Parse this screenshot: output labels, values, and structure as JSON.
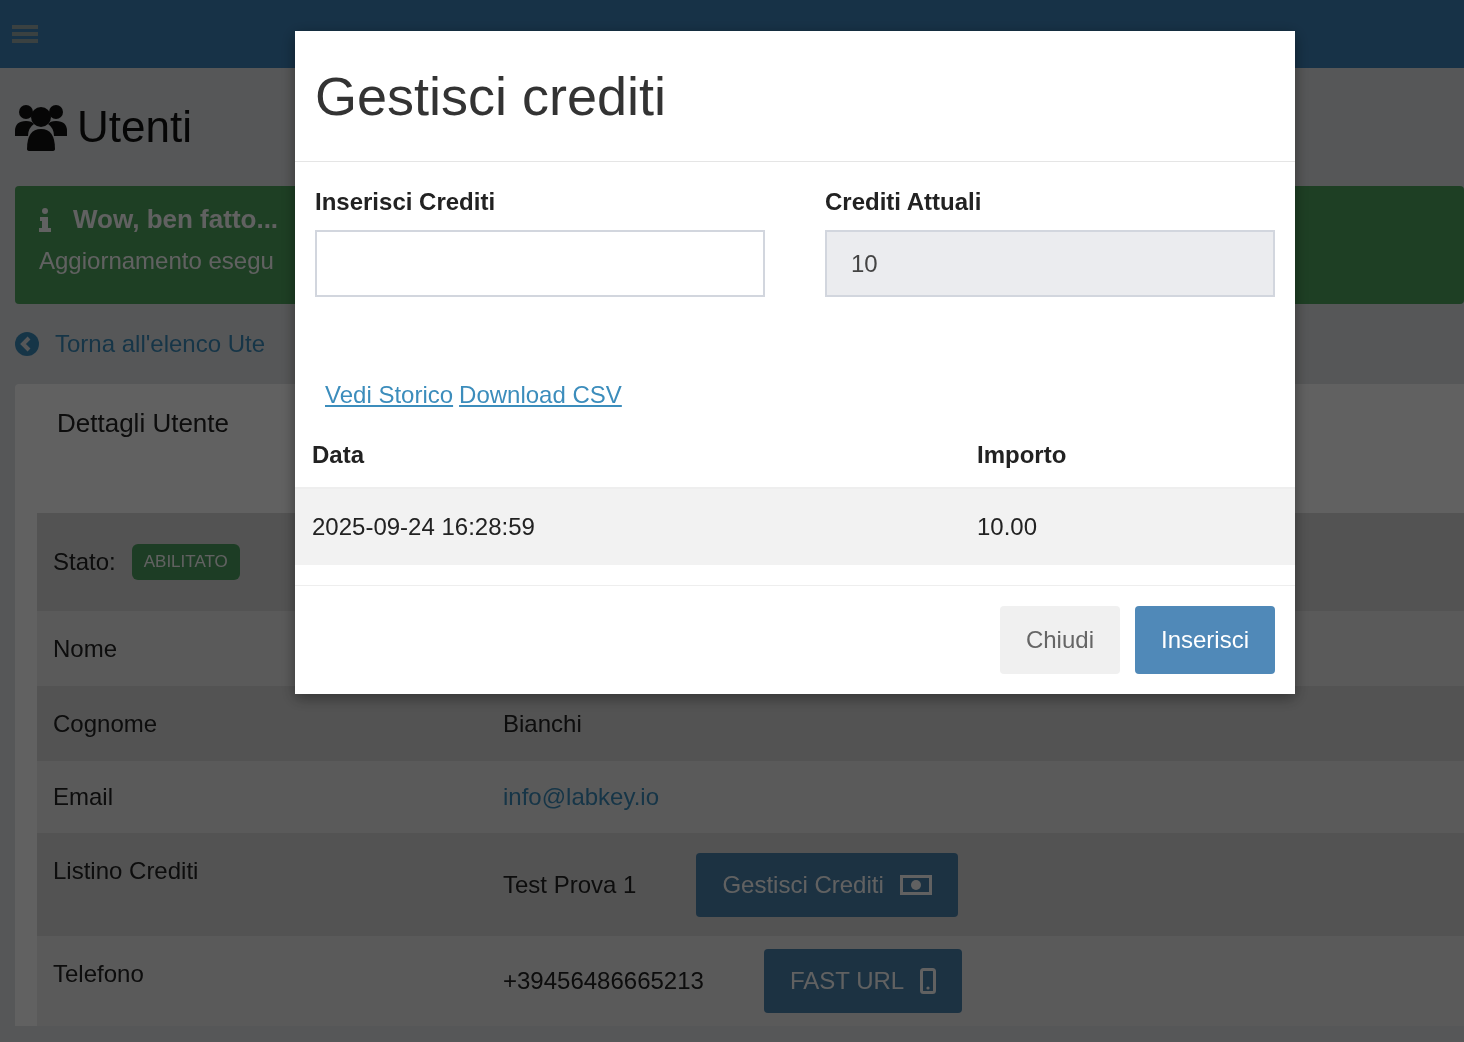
{
  "page": {
    "title": "Utenti",
    "alert": {
      "title": "Wow, ben fatto...",
      "message": "Aggiornamento esegu"
    },
    "back_link": "Torna all'elenco Ute",
    "card": {
      "title": "Dettagli Utente",
      "status": {
        "label": "Stato:",
        "badge": "ABILITATO"
      },
      "rows": [
        {
          "label": "Nome"
        },
        {
          "label": "Cognome",
          "value": "Bianchi",
          "kind": "text"
        },
        {
          "label": "Email",
          "value": "info@labkey.io",
          "kind": "link"
        },
        {
          "label": "Listino Crediti",
          "value": "Test Prova 1",
          "kind": "text",
          "button": {
            "label": "Gestisci Crediti",
            "kind": "credits"
          }
        },
        {
          "label": "Telefono",
          "value": "+39456486665213",
          "kind": "text",
          "button": {
            "label": "FAST URL",
            "kind": "phone"
          }
        }
      ]
    }
  },
  "modal": {
    "title": "Gestisci crediti",
    "fields": [
      {
        "label": "Inserisci Crediti",
        "disabled": false
      },
      {
        "label": "Crediti Attuali",
        "value": "10",
        "disabled": true
      }
    ],
    "links": [
      "Vedi Storico",
      "Download CSV"
    ],
    "table": {
      "columns": [
        "Data",
        "Importo"
      ],
      "rows": [
        [
          "2025-09-24 16:28:59",
          "10.00"
        ]
      ]
    },
    "buttons": [
      {
        "label": "Chiudi",
        "kind": "default"
      },
      {
        "label": "Inserisci",
        "kind": "primary"
      }
    ]
  }
}
